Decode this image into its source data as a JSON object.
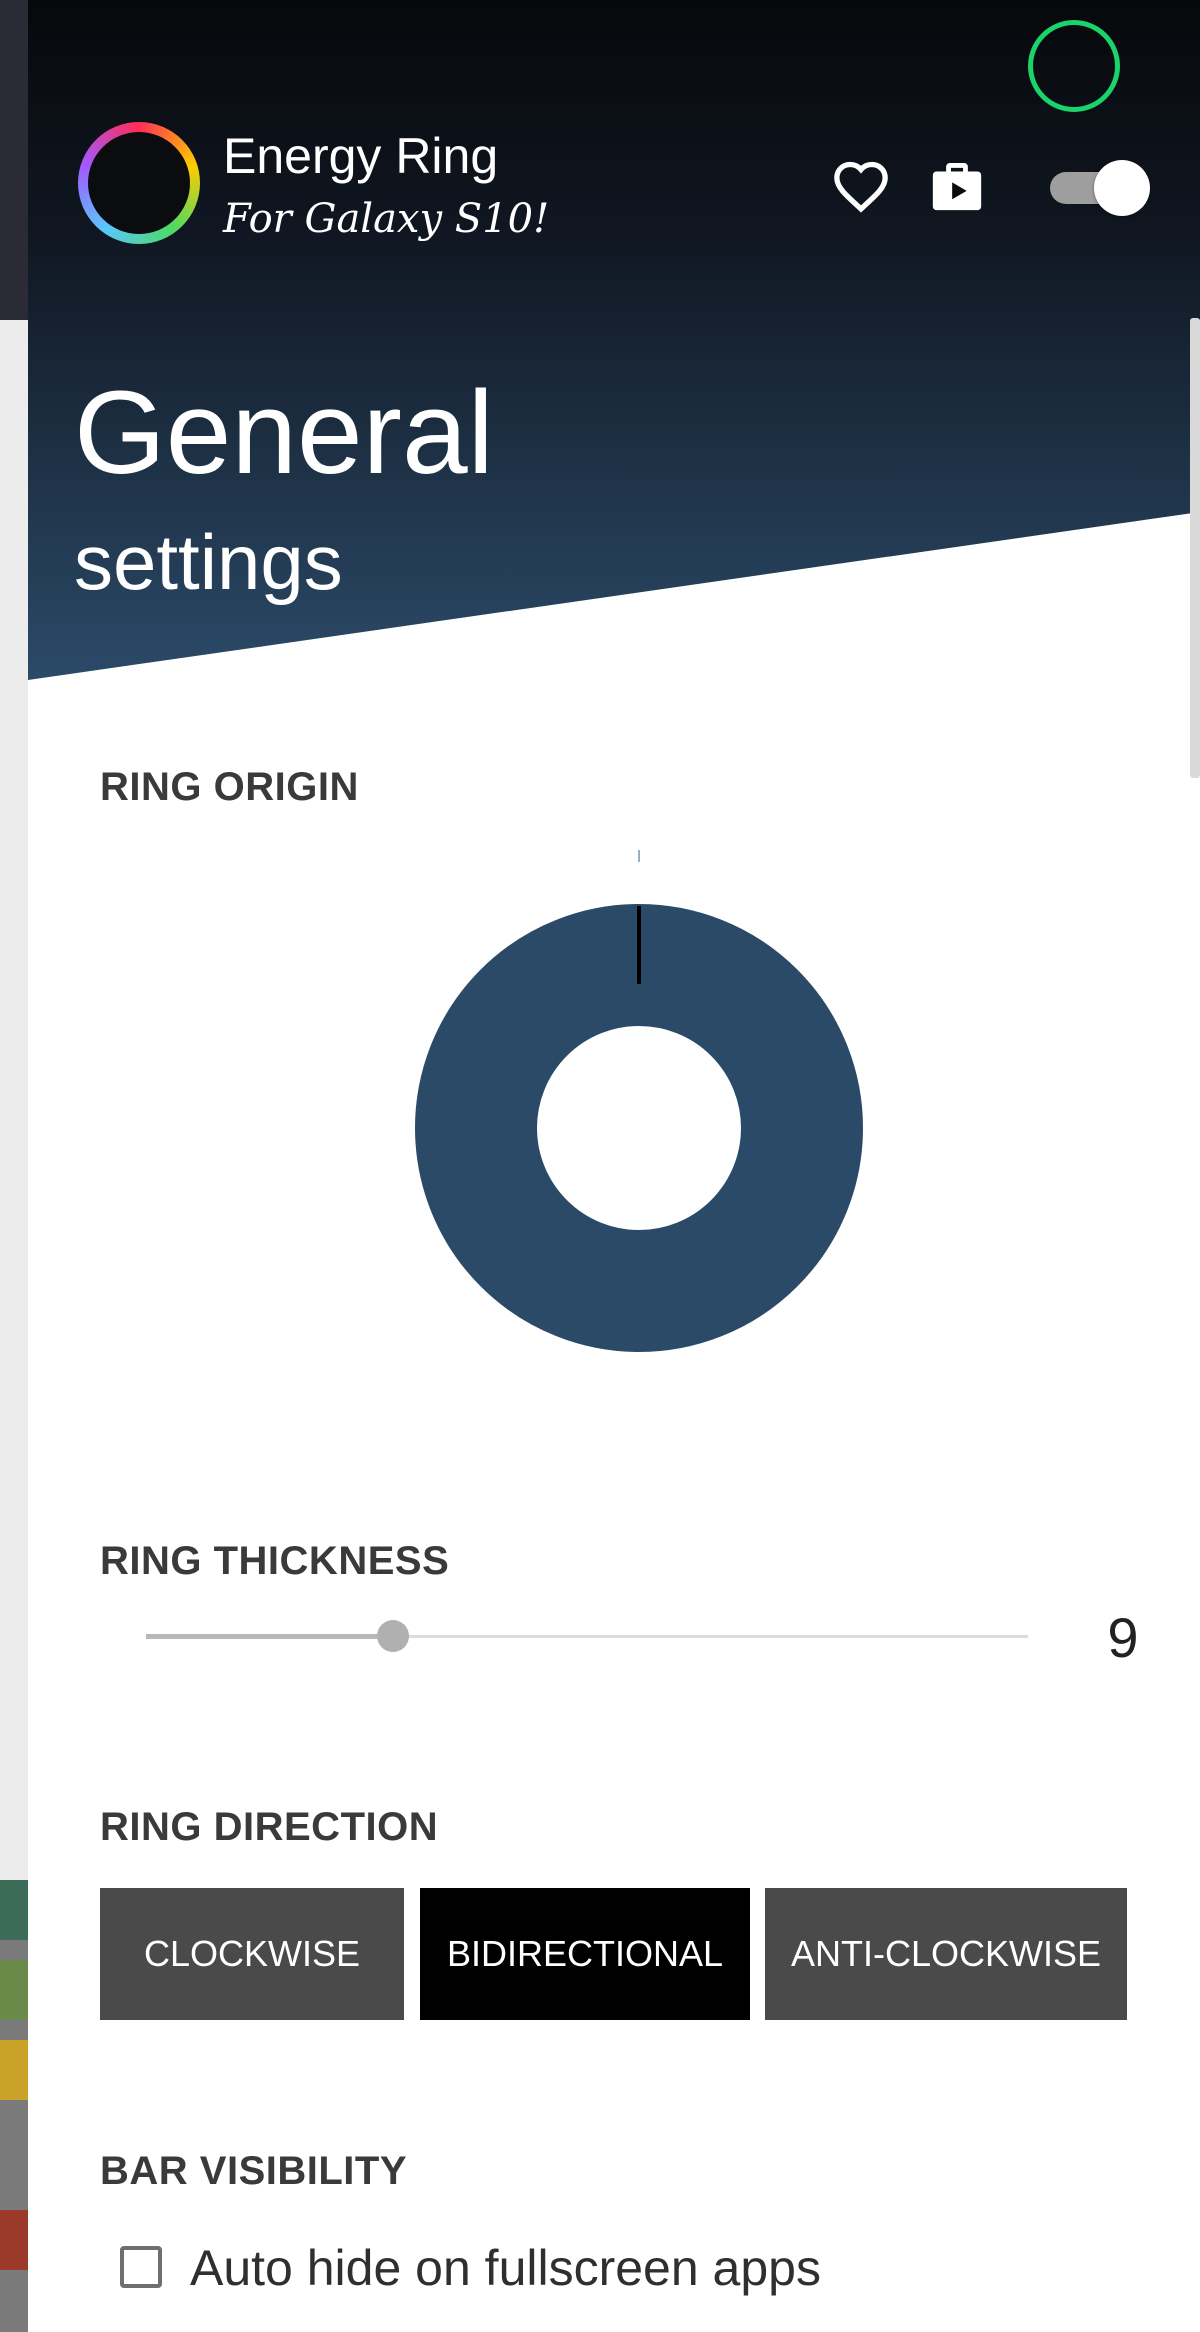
{
  "app": {
    "title": "Energy Ring",
    "subtitle": "For Galaxy S10!"
  },
  "header": {
    "title": "General",
    "subtitle": "settings",
    "actions": [
      "heart-icon",
      "store-icon",
      "enable-toggle"
    ],
    "enabled": true
  },
  "colors": {
    "header_dark": "#07080b",
    "header_blue": "#2b4a68",
    "ring": "#2b4a68",
    "accent": "#19d46a",
    "button": "#4a4a4a",
    "button_selected": "#000000"
  },
  "sections": {
    "ring_origin": "RING ORIGIN",
    "ring_thickness": "RING THICKNESS",
    "ring_direction": "RING DIRECTION",
    "bar_visibility": "BAR VISIBILITY"
  },
  "thickness": {
    "value": "9",
    "fraction": 0.28
  },
  "direction": {
    "options": [
      "CLOCKWISE",
      "BIDIRECTIONAL",
      "ANTI-CLOCKWISE"
    ],
    "selected": "BIDIRECTIONAL"
  },
  "bar_visibility": {
    "auto_hide_label": "Auto hide on fullscreen apps",
    "auto_hide_checked": false
  }
}
